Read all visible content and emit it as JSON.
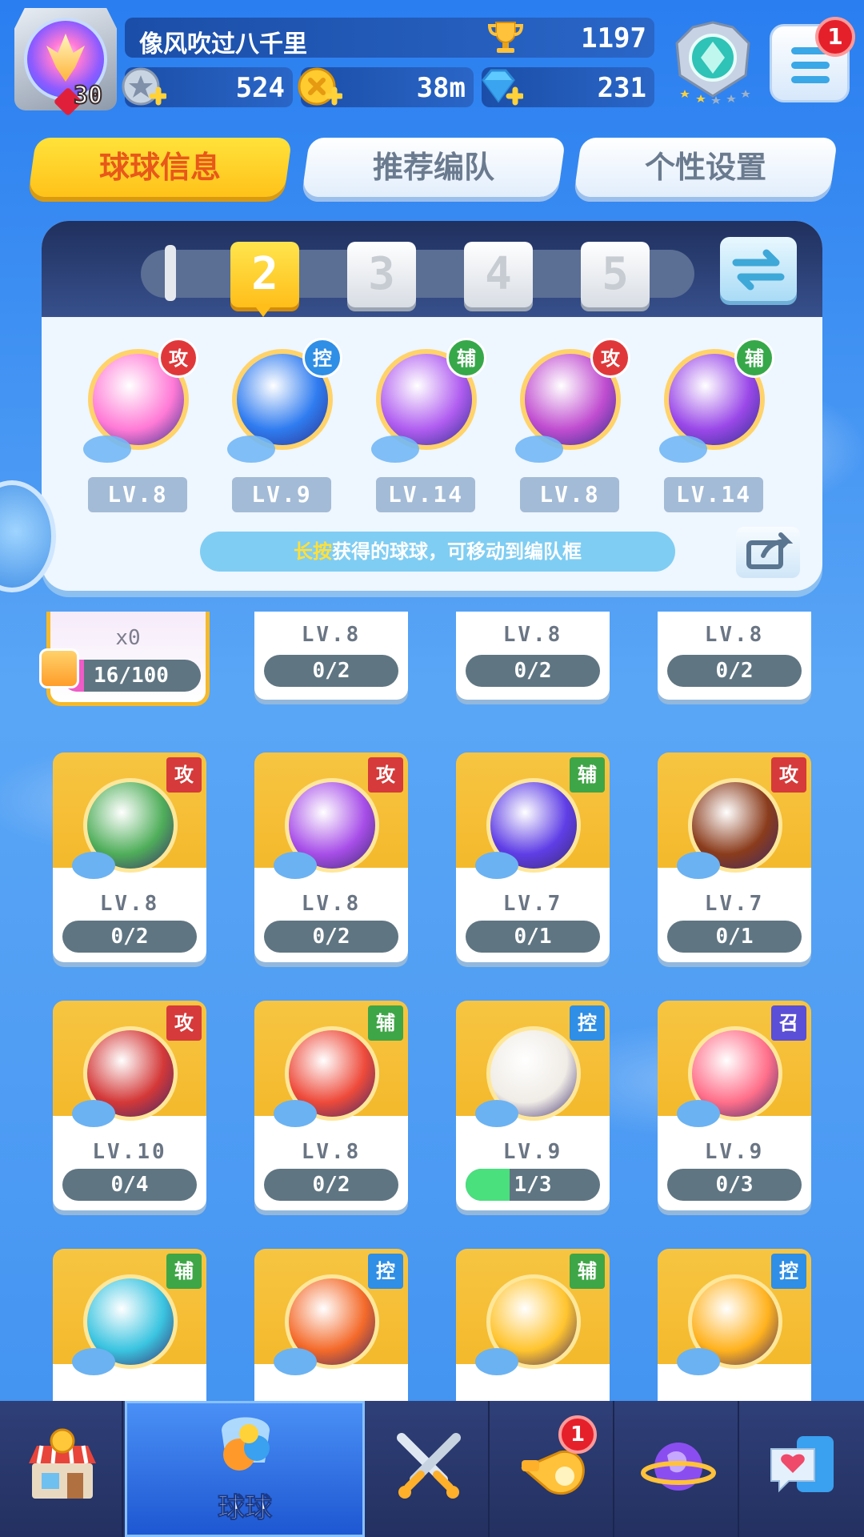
{
  "player": {
    "name": "像风吹过八千里",
    "level": "30",
    "trophies": "1197",
    "silver": "524",
    "gold": "38m",
    "gems": "231"
  },
  "menu": {
    "badge": "1"
  },
  "tabs": [
    {
      "label": "球球信息",
      "active": true
    },
    {
      "label": "推荐编队",
      "active": false
    },
    {
      "label": "个性设置",
      "active": false
    }
  ],
  "team": {
    "slots": [
      "2",
      "3",
      "4",
      "5"
    ],
    "active_slot": "2",
    "balls": [
      {
        "role": "攻",
        "level": "LV.8",
        "icon": "phoenix-ball-icon",
        "color": "#ff7ad6",
        "role_color": "#e0383a"
      },
      {
        "role": "控",
        "level": "LV.9",
        "icon": "hero-silhouette-ball-icon",
        "color": "#2f7cf0",
        "role_color": "#2f8ee6"
      },
      {
        "role": "辅",
        "level": "LV.14",
        "icon": "crowd-ball-icon",
        "color": "#b05df0",
        "role_color": "#36a84a"
      },
      {
        "role": "攻",
        "level": "LV.8",
        "icon": "robot-face-ball-icon",
        "color": "#c04dd0",
        "role_color": "#e0383a"
      },
      {
        "role": "辅",
        "level": "LV.14",
        "icon": "leaf-ball-icon",
        "color": "#9a48e8",
        "role_color": "#36a84a"
      }
    ],
    "hint_highlight": "长按",
    "hint_text": "获得的球球，可移动到编队框"
  },
  "grid": {
    "fragment_card": {
      "count": "x0",
      "progress": "16/100",
      "fraction": 0.16
    },
    "partial_row": [
      {
        "level": "LV.8",
        "progress": "0/2"
      },
      {
        "level": "LV.8",
        "progress": "0/2"
      },
      {
        "level": "LV.8",
        "progress": "0/2"
      }
    ],
    "rows": [
      [
        {
          "role": "攻",
          "role_color": "#d63a3a",
          "level": "LV.8",
          "progress": "0/2",
          "fraction": 0,
          "icon": "soldier-ball-icon",
          "color": "#4fae5a"
        },
        {
          "role": "攻",
          "role_color": "#d63a3a",
          "level": "LV.8",
          "progress": "0/2",
          "fraction": 0,
          "icon": "submarine-ball-icon",
          "color": "#a74ee8"
        },
        {
          "role": "辅",
          "role_color": "#3ea646",
          "level": "LV.7",
          "progress": "0/1",
          "fraction": 0,
          "icon": "lightning-ball-icon",
          "color": "#5f3ee6"
        },
        {
          "role": "攻",
          "role_color": "#d63a3a",
          "level": "LV.7",
          "progress": "0/1",
          "fraction": 0,
          "icon": "infinity-ball-icon",
          "color": "#8a3c1c"
        }
      ],
      [
        {
          "role": "攻",
          "role_color": "#d63a3a",
          "level": "LV.10",
          "progress": "0/4",
          "fraction": 0,
          "icon": "opera-mask-ball-icon",
          "color": "#d43838"
        },
        {
          "role": "辅",
          "role_color": "#3ea646",
          "level": "LV.8",
          "progress": "0/2",
          "fraction": 0,
          "icon": "red-envelope-ball-icon",
          "color": "#ee4a3a"
        },
        {
          "role": "控",
          "role_color": "#2f8ee6",
          "level": "LV.9",
          "progress": "1/3",
          "fraction": 0.33,
          "icon": "aries-ball-icon",
          "color": "#f0ece6"
        },
        {
          "role": "召",
          "role_color": "#5a4fd6",
          "level": "LV.9",
          "progress": "0/3",
          "fraction": 0,
          "icon": "summon-figure-ball-icon",
          "color": "#ff6f8a"
        }
      ],
      [
        {
          "role": "辅",
          "role_color": "#3ea646",
          "level": "",
          "progress": "",
          "fraction": 0,
          "icon": "angel-ball-icon",
          "color": "#3ac4e0"
        },
        {
          "role": "控",
          "role_color": "#2f8ee6",
          "level": "",
          "progress": "",
          "fraction": 0,
          "icon": "star-ball-icon",
          "color": "#f46a2a"
        },
        {
          "role": "辅",
          "role_color": "#3ea646",
          "level": "",
          "progress": "",
          "fraction": 0,
          "icon": "sun-ball-icon",
          "color": "#ffc42e"
        },
        {
          "role": "控",
          "role_color": "#2f8ee6",
          "level": "",
          "progress": "",
          "fraction": 0,
          "icon": "gem-ball-icon",
          "color": "#ffb21e"
        }
      ]
    ]
  },
  "bottom_nav": [
    {
      "icon": "shop-icon",
      "label": "",
      "active": false,
      "badge": ""
    },
    {
      "icon": "balls-icon",
      "label": "球球",
      "active": true,
      "badge": ""
    },
    {
      "icon": "crossed-swords-icon",
      "label": "",
      "active": false,
      "badge": ""
    },
    {
      "icon": "whistle-icon",
      "label": "",
      "active": false,
      "badge": "1"
    },
    {
      "icon": "planet-icon",
      "label": "",
      "active": false,
      "badge": ""
    },
    {
      "icon": "heart-chat-icon",
      "label": "",
      "active": false,
      "badge": ""
    }
  ]
}
